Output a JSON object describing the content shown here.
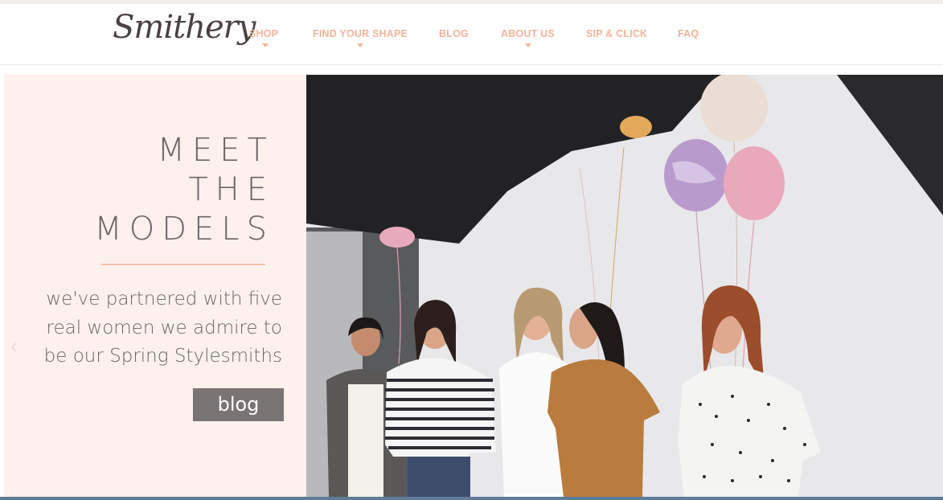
{
  "header": {
    "logo_text": "Smithery",
    "nav": [
      {
        "label": "SHOP",
        "has_dropdown": true
      },
      {
        "label": "FIND YOUR SHAPE",
        "has_dropdown": true
      },
      {
        "label": "BLOG",
        "has_dropdown": false
      },
      {
        "label": "ABOUT US",
        "has_dropdown": true
      },
      {
        "label": "SIP & CLICK",
        "has_dropdown": false
      },
      {
        "label": "FAQ",
        "has_dropdown": false
      }
    ]
  },
  "hero": {
    "title_lines": [
      "MEET",
      "THE",
      "MODELS"
    ],
    "subtitle_lines": [
      "we've partnered with five",
      "real women we admire to",
      "be our Spring Stylesmiths"
    ],
    "button_label": "blog",
    "prev_icon": "chevron-left-icon",
    "photo_alt": "five women laughing with balloons in a photo studio"
  },
  "colors": {
    "accent": "#f3b49a",
    "panel_bg": "#fdf1ee",
    "text": "#6b6566",
    "button": "#7a7474"
  }
}
